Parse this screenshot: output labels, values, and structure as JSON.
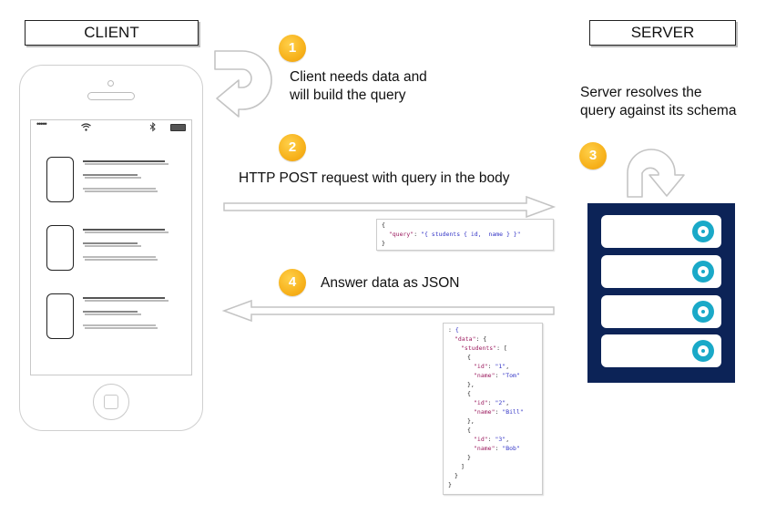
{
  "client": {
    "title": "CLIENT",
    "phone": {
      "status_bar": {
        "signal": "•••••",
        "wifi_icon": "wifi-icon",
        "bluetooth_icon": "bluetooth-icon",
        "battery_icon": "battery-icon"
      },
      "list_items": 3
    }
  },
  "server": {
    "title": "SERVER",
    "rack_units": 4
  },
  "steps": [
    {
      "number": "1",
      "text_line1": "Client needs data and",
      "text_line2": "will build the query"
    },
    {
      "number": "2",
      "text": "HTTP POST request with query in the body"
    },
    {
      "number": "3",
      "text_line1": "Server resolves the",
      "text_line2": "query against its schema"
    },
    {
      "number": "4",
      "text": "Answer data as JSON"
    }
  ],
  "request_body": {
    "open": "{",
    "key": "\"query\"",
    "sep": ": ",
    "value": "\"{ students { id,  name } }\"",
    "close": "}"
  },
  "response_body": {
    "lines": [
      {
        "indent": 0,
        "key": "",
        "value": "{",
        "tail": ""
      },
      {
        "indent": 1,
        "key": "\"data\"",
        "value": "",
        "tail": ": {"
      },
      {
        "indent": 2,
        "key": "\"students\"",
        "value": "",
        "tail": ": ["
      },
      {
        "indent": 3,
        "key": "",
        "value": "",
        "tail": "{"
      },
      {
        "indent": 4,
        "key": "\"id\"",
        "value": "\"1\"",
        "tail": ","
      },
      {
        "indent": 4,
        "key": "\"name\"",
        "value": "\"Tom\"",
        "tail": ""
      },
      {
        "indent": 3,
        "key": "",
        "value": "",
        "tail": "},"
      },
      {
        "indent": 3,
        "key": "",
        "value": "",
        "tail": "{"
      },
      {
        "indent": 4,
        "key": "\"id\"",
        "value": "\"2\"",
        "tail": ","
      },
      {
        "indent": 4,
        "key": "\"name\"",
        "value": "\"Bill\"",
        "tail": ""
      },
      {
        "indent": 3,
        "key": "",
        "value": "",
        "tail": "},"
      },
      {
        "indent": 3,
        "key": "",
        "value": "",
        "tail": "{"
      },
      {
        "indent": 4,
        "key": "\"id\"",
        "value": "\"3\"",
        "tail": ","
      },
      {
        "indent": 4,
        "key": "\"name\"",
        "value": "\"Bob\"",
        "tail": ""
      },
      {
        "indent": 3,
        "key": "",
        "value": "",
        "tail": "}"
      },
      {
        "indent": 2,
        "key": "",
        "value": "",
        "tail": "]"
      },
      {
        "indent": 1,
        "key": "",
        "value": "",
        "tail": "}"
      },
      {
        "indent": 0,
        "key": "",
        "value": "",
        "tail": "}"
      }
    ]
  },
  "colors": {
    "badge": "#f7b21c",
    "server_rack": "#0c2357",
    "disk": "#1aa9c8",
    "json_key": "#9b1a5e",
    "json_string": "#3334c6",
    "arrow_outline": "#c4c4c4"
  }
}
